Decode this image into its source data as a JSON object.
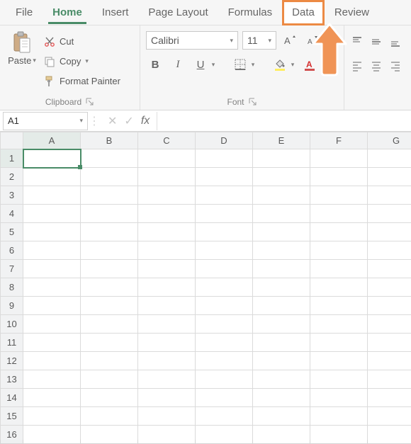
{
  "tabs": {
    "file": "File",
    "home": "Home",
    "insert": "Insert",
    "page_layout": "Page Layout",
    "formulas": "Formulas",
    "data": "Data",
    "review": "Review"
  },
  "clipboard": {
    "paste": "Paste",
    "cut": "Cut",
    "copy": "Copy",
    "format_painter": "Format Painter",
    "group_label": "Clipboard"
  },
  "font": {
    "name": "Calibri",
    "size": "11",
    "bold": "B",
    "italic": "I",
    "underline": "U",
    "font_color_letter": "A",
    "group_label": "Font"
  },
  "fx": {
    "namebox": "A1",
    "fx_label": "fx"
  },
  "grid": {
    "cols": [
      "A",
      "B",
      "C",
      "D",
      "E",
      "F",
      "G"
    ],
    "rows": [
      "1",
      "2",
      "3",
      "4",
      "5",
      "6",
      "7",
      "8",
      "9",
      "10",
      "11",
      "12",
      "13",
      "14",
      "15",
      "16"
    ]
  }
}
